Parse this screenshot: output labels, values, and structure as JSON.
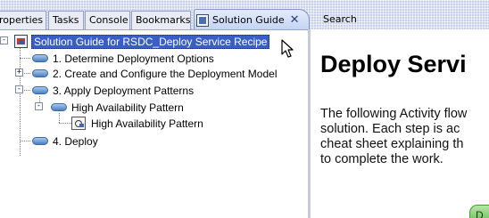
{
  "tabs": [
    {
      "label": "roperties"
    },
    {
      "label": "Tasks"
    },
    {
      "label": "Console"
    },
    {
      "label": "Bookmarks"
    },
    {
      "label": "Solution Guide",
      "active": true,
      "close_glyph": "✕"
    },
    {
      "label": "Search"
    }
  ],
  "tree": {
    "root": {
      "label": "Solution Guide for RSDC_Deploy Service Recipe",
      "icon": "solution-guide-icon",
      "selected": true
    },
    "items": [
      {
        "label": "1. Determine Deployment Options",
        "icon": "step-pill-icon"
      },
      {
        "label": "2. Create and Configure the Deployment Model",
        "icon": "step-pill-icon",
        "expander": "+"
      },
      {
        "label": "3. Apply Deployment Patterns",
        "icon": "step-pill-icon",
        "expander": "-"
      },
      {
        "label": "High Availability Pattern",
        "icon": "step-pill-icon",
        "expander": "-"
      },
      {
        "label": "High Availability Pattern",
        "icon": "pattern-icon"
      },
      {
        "label": "4. Deploy",
        "icon": "step-pill-icon"
      }
    ]
  },
  "content": {
    "title": "Deploy Servi",
    "body_lines": [
      "The following Activity flow",
      "solution. Each step is ac",
      "cheat sheet explaining th",
      "to complete the work."
    ],
    "button_label": "D"
  },
  "colors": {
    "tabbar": "#c7d0ea",
    "selection": "#3a5ec8",
    "pill": "#4a7fc1",
    "button_green": "#5cb54a"
  }
}
